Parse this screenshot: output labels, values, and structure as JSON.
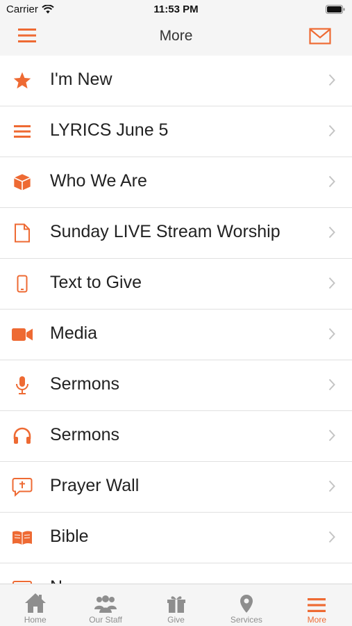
{
  "status_bar": {
    "carrier": "Carrier",
    "time": "11:53 PM"
  },
  "header": {
    "title": "More"
  },
  "accent_color": "#ee6a33",
  "menu_items": [
    {
      "label": "I'm New",
      "icon": "star-icon"
    },
    {
      "label": "LYRICS June 5",
      "icon": "list-icon"
    },
    {
      "label": "Who We Are",
      "icon": "box-icon"
    },
    {
      "label": "Sunday LIVE Stream Worship",
      "icon": "document-icon"
    },
    {
      "label": "Text to Give",
      "icon": "phone-icon"
    },
    {
      "label": "Media",
      "icon": "video-camera-icon"
    },
    {
      "label": "Sermons",
      "icon": "microphone-icon"
    },
    {
      "label": "Sermons",
      "icon": "headphones-icon"
    },
    {
      "label": "Prayer Wall",
      "icon": "prayer-bubble-icon"
    },
    {
      "label": "Bible",
      "icon": "open-book-icon"
    },
    {
      "label": "N",
      "icon": "partial-icon"
    }
  ],
  "tab_bar": {
    "tabs": [
      {
        "label": "Home",
        "icon": "home-icon"
      },
      {
        "label": "Our Staff",
        "icon": "people-icon"
      },
      {
        "label": "Give",
        "icon": "gift-icon"
      },
      {
        "label": "Services",
        "icon": "map-pin-icon"
      },
      {
        "label": "More",
        "icon": "menu-icon"
      }
    ],
    "active": "More"
  }
}
